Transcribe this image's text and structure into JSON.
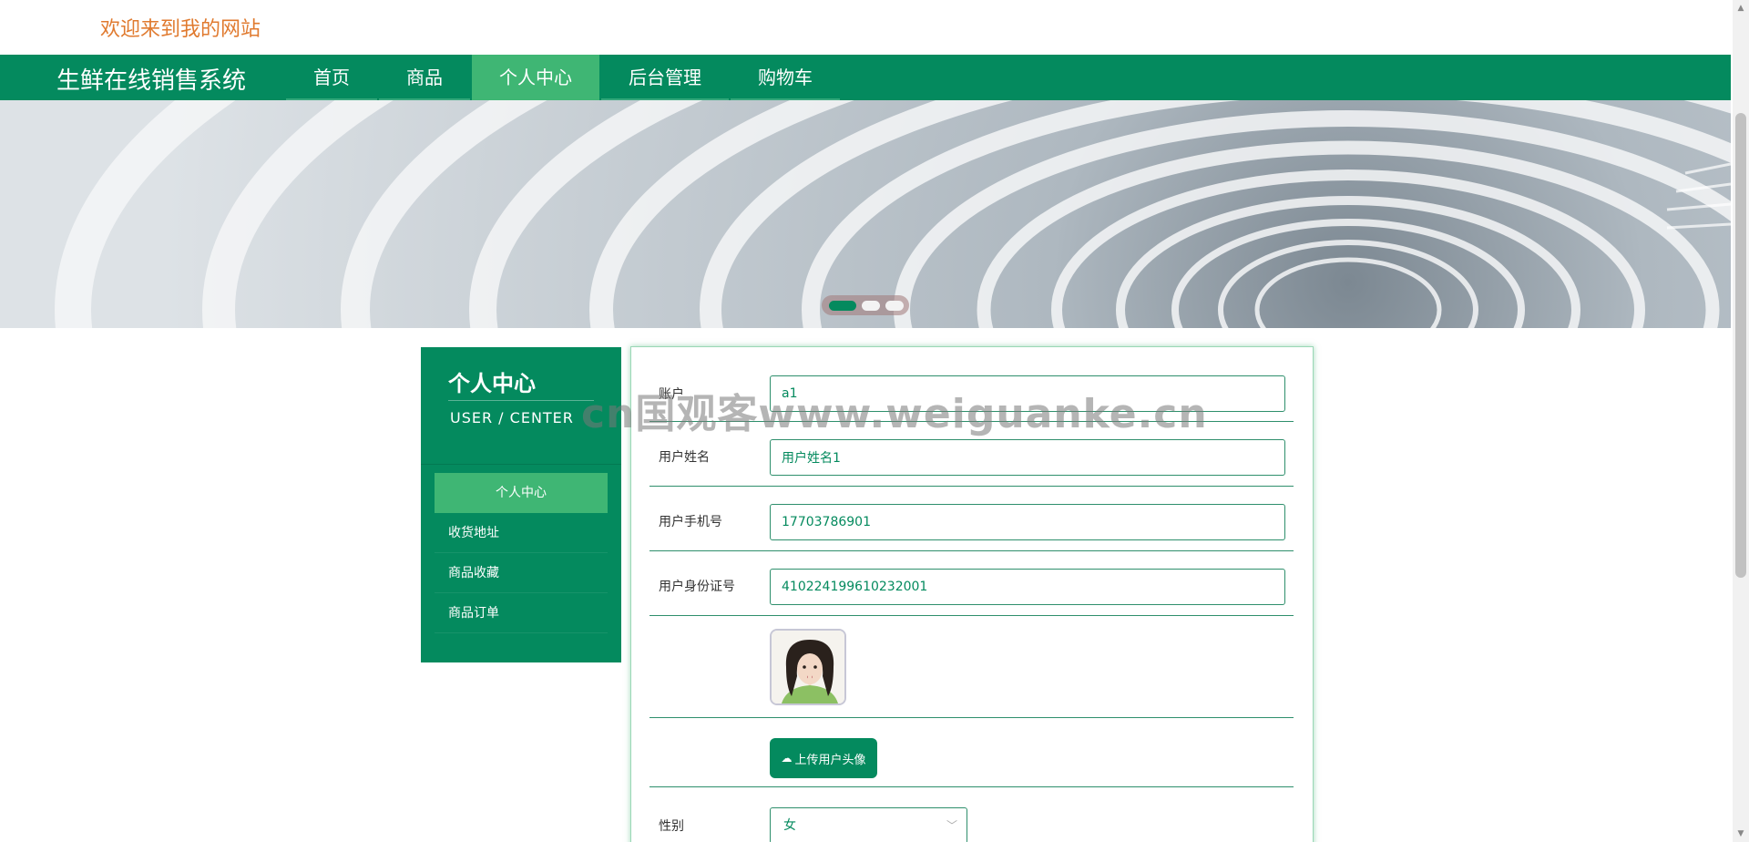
{
  "welcome": "欢迎来到我的网站",
  "site_title": "生鲜在线销售系统",
  "nav": [
    {
      "label": "首页",
      "active": false
    },
    {
      "label": "商品",
      "active": false
    },
    {
      "label": "个人中心",
      "active": true
    },
    {
      "label": "后台管理",
      "active": false
    },
    {
      "label": "购物车",
      "active": false
    }
  ],
  "carousel": {
    "slides": 3,
    "active_index": 0,
    "active_color": "#048a5e"
  },
  "sidebar": {
    "title": "个人中心",
    "subtitle": "USER / CENTER",
    "items": [
      {
        "label": "个人中心",
        "active": true
      },
      {
        "label": "收货地址",
        "active": false
      },
      {
        "label": "商品收藏",
        "active": false
      },
      {
        "label": "商品订单",
        "active": false
      }
    ]
  },
  "form": {
    "account_label": "账户",
    "account_value": "a1",
    "name_label": "用户姓名",
    "name_value": "用户姓名1",
    "phone_label": "用户手机号",
    "phone_value": "17703786901",
    "idcard_label": "用户身份证号",
    "idcard_value": "410224199610232001",
    "upload_label": "上传用户头像",
    "gender_label": "性别",
    "gender_value": "女"
  },
  "watermark": "cn国观客www.weiguanke.cn",
  "colors": {
    "primary": "#048a5e",
    "active": "#3fb674",
    "welcome": "#e07a2f"
  }
}
